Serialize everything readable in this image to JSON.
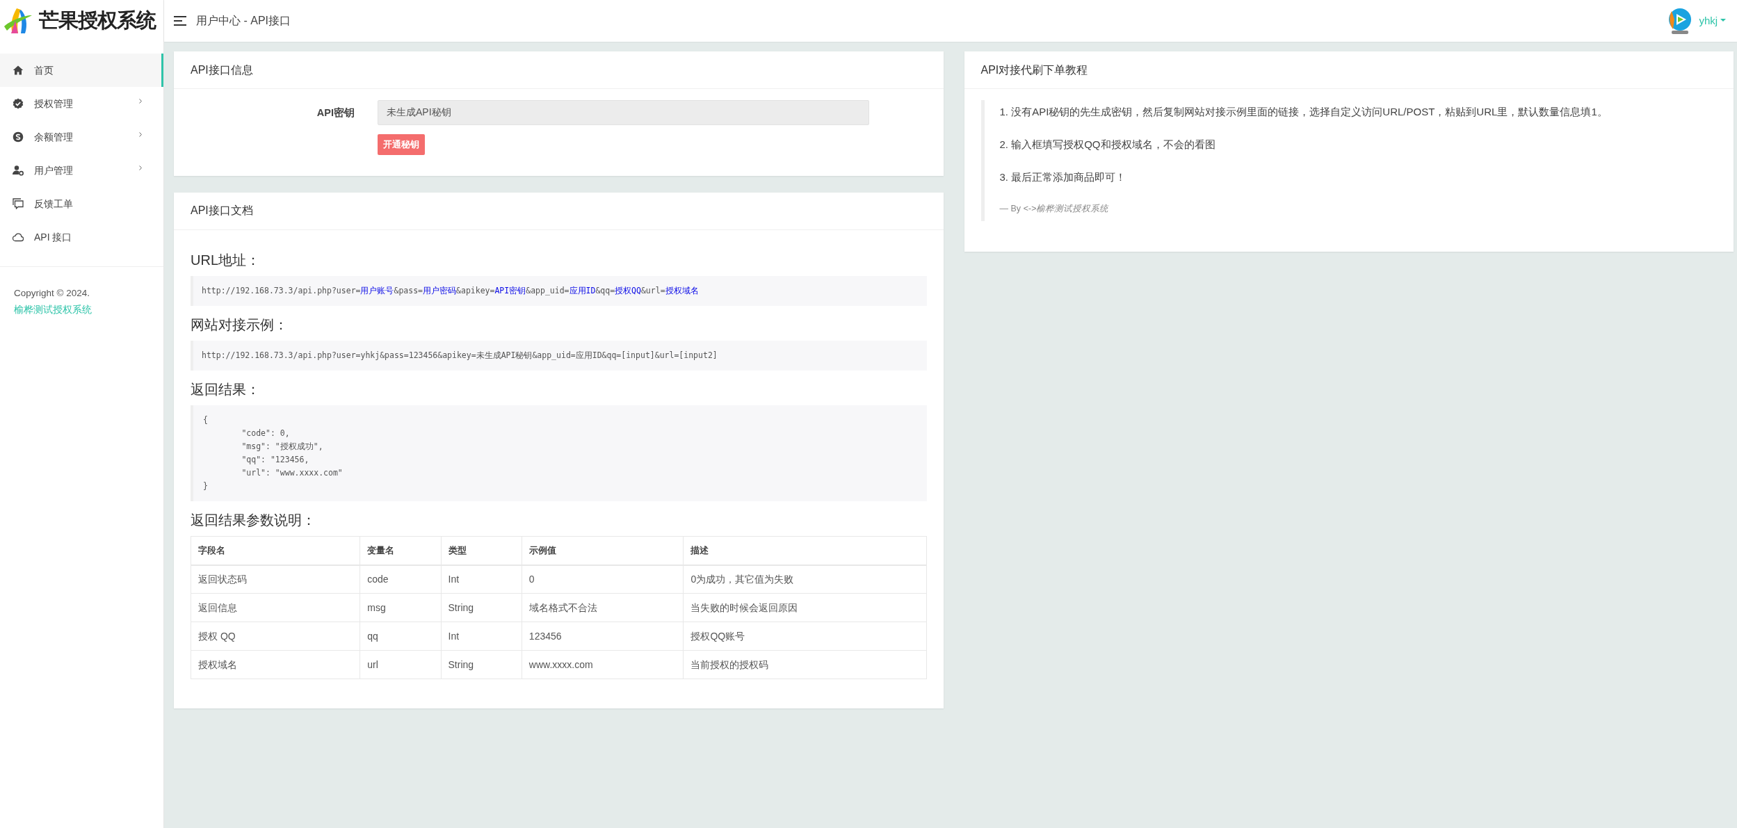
{
  "brand": {
    "title": "芒果授权系统"
  },
  "sidebar": {
    "items": [
      {
        "label": "首页",
        "kind": "home",
        "selected": true,
        "has_submenu": false
      },
      {
        "label": "授权管理",
        "kind": "badge",
        "selected": false,
        "has_submenu": true
      },
      {
        "label": "余额管理",
        "kind": "coin",
        "selected": false,
        "has_submenu": true
      },
      {
        "label": "用户管理",
        "kind": "user",
        "selected": false,
        "has_submenu": true
      },
      {
        "label": "反馈工单",
        "kind": "chat",
        "selected": false,
        "has_submenu": false
      },
      {
        "label": "API 接口",
        "kind": "cloud",
        "selected": false,
        "has_submenu": false
      }
    ],
    "copyright": "Copyright © 2024.",
    "copyright_link": "榆桦测试授权系统"
  },
  "header": {
    "title": "用户中心 - API接口",
    "user": "yhkj"
  },
  "api_info": {
    "title": "API接口信息",
    "key_label": "API密钥",
    "key_value": "未生成API秘钥",
    "button": "开通秘钥"
  },
  "api_doc": {
    "title": "API接口文档",
    "sections": [
      {
        "heading": "URL地址：",
        "kind": "url",
        "segments": [
          {
            "text": "http://192.168.73.3/api.php?user=",
            "kind": "plain"
          },
          {
            "text": "用户账号",
            "kind": "param"
          },
          {
            "text": "&pass=",
            "kind": "plain"
          },
          {
            "text": "用户密码",
            "kind": "param"
          },
          {
            "text": "&apikey=",
            "kind": "plain"
          },
          {
            "text": "API密钥",
            "kind": "param"
          },
          {
            "text": "&app_uid=",
            "kind": "plain"
          },
          {
            "text": "应用ID",
            "kind": "param"
          },
          {
            "text": "&qq=",
            "kind": "plain"
          },
          {
            "text": "授权QQ",
            "kind": "param"
          },
          {
            "text": "&url=",
            "kind": "plain"
          },
          {
            "text": "授权域名",
            "kind": "param"
          }
        ]
      },
      {
        "heading": "网站对接示例：",
        "kind": "url",
        "segments": [
          {
            "text": "http://192.168.73.3/api.php?user=yhkj&pass=123456&apikey=未生成API秘钥&app_uid=应用ID&qq=[input]&url=[input2]",
            "kind": "plain"
          }
        ]
      },
      {
        "heading": "返回结果：",
        "kind": "code",
        "code": "{\n\t\"code\": 0,\n\t\"msg\": \"授权成功\",\n\t\"qq\": \"123456,\n\t\"url\": \"www.xxxx.com\"\n}"
      },
      {
        "heading": "返回结果参数说明：",
        "kind": "table",
        "columns": [
          "字段名",
          "变量名",
          "类型",
          "示例值",
          "描述"
        ],
        "rows": [
          [
            "返回状态码",
            "code",
            "Int",
            "0",
            "0为成功，其它值为失败"
          ],
          [
            "返回信息",
            "msg",
            "String",
            "域名格式不合法",
            "当失败的时候会返回原因"
          ],
          [
            "授权 QQ",
            "qq",
            "Int",
            "123456",
            "授权QQ账号"
          ],
          [
            "授权域名",
            "url",
            "String",
            "www.xxxx.com",
            "当前授权的授权码"
          ]
        ]
      }
    ]
  },
  "tutorial": {
    "title": "API对接代刷下单教程",
    "steps": [
      "1. 没有API秘钥的先生成密钥，然后复制网站对接示例里面的链接，选择自定义访问URL/POST，粘贴到URL里，默认数量信息填1。",
      "2. 输入框填写授权QQ和授权域名，不会的看图",
      "3. 最后正常添加商品即可！"
    ],
    "footer": "— By *<->榆桦测试授权系统*"
  }
}
